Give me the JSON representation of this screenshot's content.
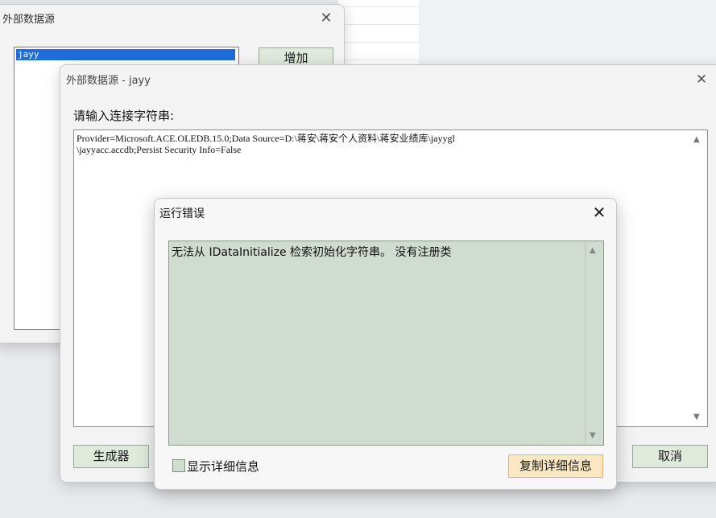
{
  "window_main": {
    "title": "外部数据源",
    "list_items": [
      "jayy"
    ],
    "add_button": "增加"
  },
  "window_conn": {
    "title": "外部数据源 - jayy",
    "prompt": "请输入连接字符串:",
    "connection_string": "Provider=Microsoft.ACE.OLEDB.15.0;Data Source=D:\\蒋安\\蒋安个人资料\\蒋安业绩库\\jayygl\n\\jayyacc.accdb;Persist Security Info=False",
    "generator_button": "生成器",
    "cancel_button": "取消"
  },
  "window_error": {
    "title": "运行错误",
    "message": "无法从 IDataInitialize 检索初始化字符串。 没有注册类",
    "show_details_label": "显示详细信息",
    "copy_details_button": "复制详细信息"
  },
  "colors": {
    "selection": "#1e6ddb",
    "button_bg": "#dfe9dc",
    "error_bg": "#cfdccf",
    "copy_button_bg": "#fbe7c2"
  }
}
